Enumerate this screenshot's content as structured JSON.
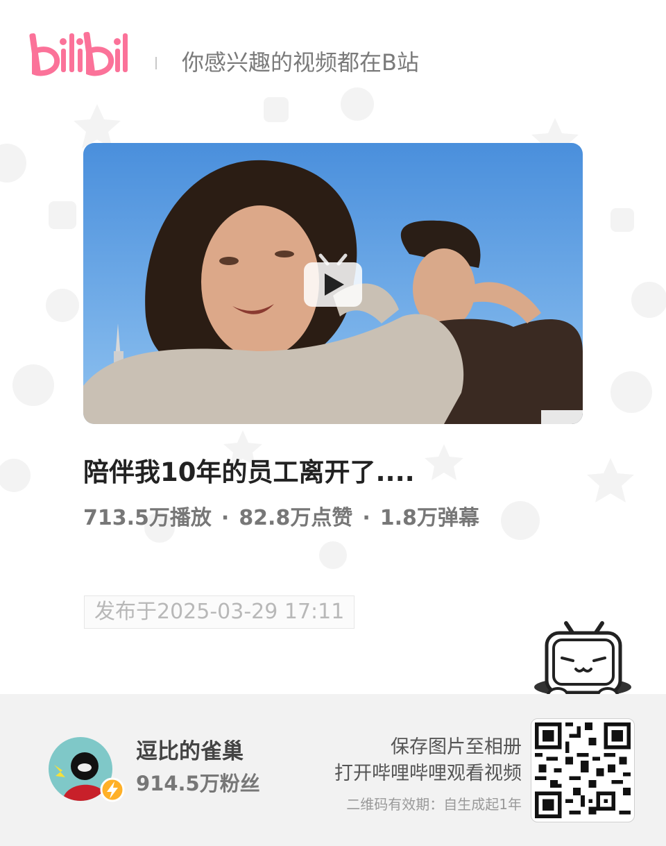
{
  "header": {
    "logo_text": "bilibili",
    "slogan": "你感兴趣的视频都在B站"
  },
  "video": {
    "title": "陪伴我10年的员工离开了....",
    "views": "713.5万播放",
    "likes": "82.8万点赞",
    "danmaku": "1.8万弹幕",
    "separator": "·",
    "publish_date": "发布于2025-03-29 17:11"
  },
  "uploader": {
    "name": "逗比的雀巢",
    "fans": "914.5万粉丝"
  },
  "qr": {
    "line1": "保存图片至相册",
    "line2": "打开哔哩哔哩观看视频",
    "note": "二维码有效期：自生成起1年"
  },
  "colors": {
    "brand_pink": "#fb7299",
    "text_dark": "#222222",
    "text_gray": "#777777",
    "footer_bg": "#f2f2f2",
    "badge_yellow": "#ffb027"
  },
  "icons": {
    "play": "play-icon",
    "mascot": "tv-mascot-icon",
    "verified": "lightning-badge-icon"
  }
}
